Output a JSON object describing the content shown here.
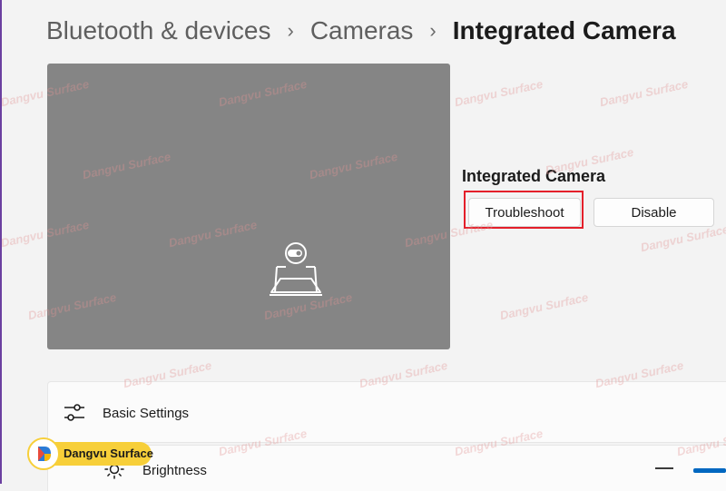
{
  "breadcrumb": {
    "items": [
      "Bluetooth & devices",
      "Cameras"
    ],
    "current": "Integrated Camera",
    "separator": "›"
  },
  "camera": {
    "name": "Integrated Camera",
    "preview_icon": "camera-off-laptop-icon"
  },
  "actions": {
    "troubleshoot_label": "Troubleshoot",
    "disable_label": "Disable",
    "highlight_color": "#e41f2a"
  },
  "settings": {
    "section_label": "Basic Settings",
    "section_icon": "sliders-icon",
    "brightness_label": "Brightness",
    "brightness_icon": "sun-icon"
  },
  "watermark": {
    "badge_text": "Dangvu Surface",
    "text": "Dangvu Surface"
  },
  "colors": {
    "background": "#f3f3f3",
    "preview_bg": "#858585",
    "accent": "#0067c0",
    "badge": "#f7cf39"
  }
}
